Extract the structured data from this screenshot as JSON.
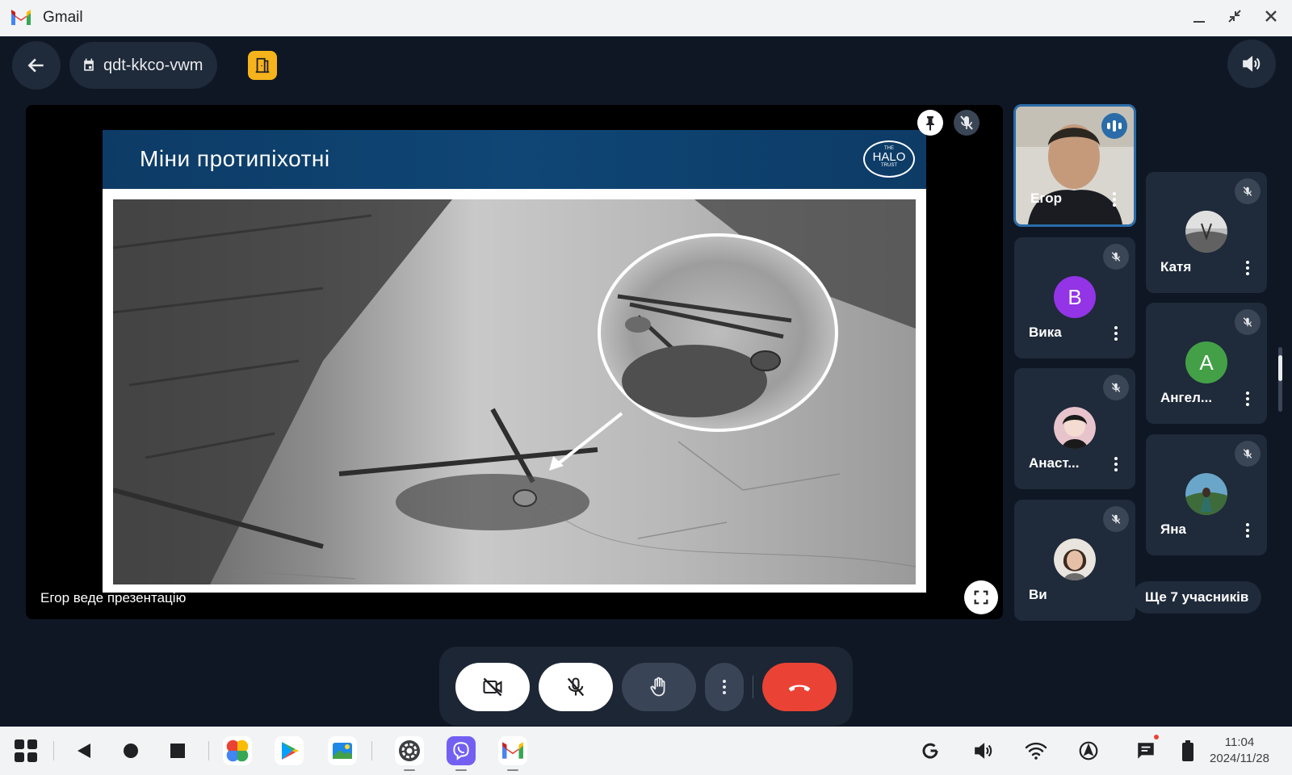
{
  "window": {
    "app_name": "Gmail"
  },
  "header": {
    "meeting_code": "qdt-kkco-vwm"
  },
  "presentation": {
    "slide_title": "Міни протипіхотні",
    "logo_top": "THE",
    "logo_main": "HALO",
    "logo_bottom": "TRUST",
    "presenter_text": "Егор веде презентацію"
  },
  "participants": [
    {
      "name": "Егор",
      "type": "video",
      "speaking": true
    },
    {
      "name": "Вика",
      "type": "initial",
      "initial": "В",
      "color": "#9334e6"
    },
    {
      "name": "Анаст...",
      "type": "photo"
    },
    {
      "name": "Ви",
      "type": "photo"
    },
    {
      "name": "Катя",
      "type": "photo"
    },
    {
      "name": "Ангел...",
      "type": "initial",
      "initial": "А",
      "color": "#43a047"
    },
    {
      "name": "Яна",
      "type": "photo"
    }
  ],
  "more_participants": "Ще 7 учасників",
  "controls": {
    "camera": "camera-off",
    "mic": "mic-off",
    "raise_hand": "hand",
    "more": "more-vert",
    "end_call": "end-call",
    "end_call_color": "#ea4335"
  },
  "taskbar": {
    "time": "11:04",
    "date": "2024/11/28"
  },
  "colors": {
    "background": "#0f1724",
    "tile": "#1f2a3a",
    "accent": "#2b6ca8",
    "exit_badge": "#f6b31b"
  }
}
